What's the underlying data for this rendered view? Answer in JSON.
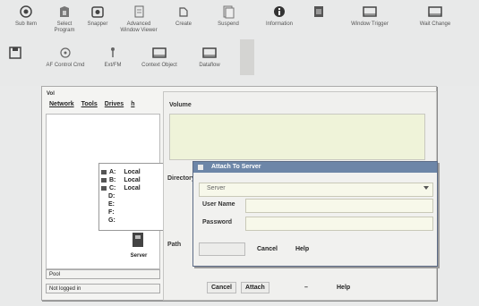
{
  "toolbar": {
    "row1": [
      {
        "label": "Sub Item",
        "icon": "record-icon"
      },
      {
        "label": "Select Program",
        "icon": "program-icon"
      },
      {
        "label": "Snapper",
        "icon": "camera-icon"
      },
      {
        "label": "Advanced Window Viewer",
        "icon": "document-icon"
      },
      {
        "label": "Create",
        "icon": "pen-icon"
      },
      {
        "label": "Suspend",
        "icon": "pages-icon"
      },
      {
        "label": "Information",
        "icon": "info-icon"
      },
      {
        "label": "",
        "icon": "film-icon"
      },
      {
        "label": "Window Trigger",
        "icon": "window-icon"
      },
      {
        "label": "Wait Change",
        "icon": "window-icon-2"
      }
    ],
    "row2": [
      {
        "label": "",
        "icon": "save-icon"
      },
      {
        "label": "AF Control Cmd",
        "icon": "target-icon"
      },
      {
        "label": "Ext/FM",
        "icon": "pin-icon"
      },
      {
        "label": "Context Object",
        "icon": "window-icon-3"
      },
      {
        "label": "Dataflow",
        "icon": "window-icon-4"
      }
    ]
  },
  "main_window": {
    "title": "Vol",
    "menu": [
      "Network",
      "Tools",
      "Drives",
      "h"
    ],
    "drives": [
      {
        "letter": "A:",
        "type": "Local"
      },
      {
        "letter": "B:",
        "type": "Local"
      },
      {
        "letter": "C:",
        "type": "Local"
      },
      {
        "letter": "D:",
        "type": ""
      },
      {
        "letter": "E:",
        "type": ""
      },
      {
        "letter": "F:",
        "type": ""
      },
      {
        "letter": "G:",
        "type": ""
      }
    ],
    "tray_label": "Server",
    "status_1": "Pool",
    "status_2": "Not logged in"
  },
  "connect_panel": {
    "volume_label": "Volume",
    "directory_label": "Directory",
    "path_label": "Path",
    "buttons": {
      "cancel": "Cancel",
      "attach": "Attach",
      "help": "Help",
      "separator": "–"
    }
  },
  "dialog": {
    "title": "Attach To Server",
    "server_placeholder": "Server",
    "username_label": "User Name",
    "password_label": "Password",
    "ok": "",
    "cancel": "Cancel",
    "help": "Help"
  },
  "colors": {
    "dialog_title": "#6d86a8",
    "input_bg": "#f7f8ea",
    "volume_box_bg": "#eff3d9"
  }
}
